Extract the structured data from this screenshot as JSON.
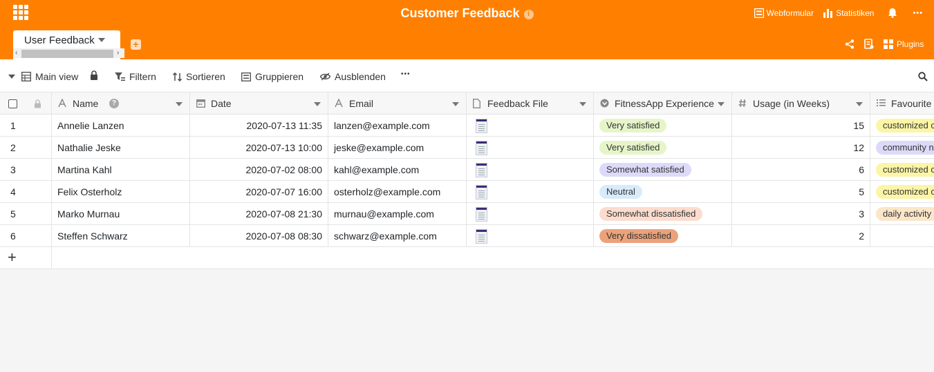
{
  "header": {
    "title": "Customer Feedback",
    "info_glyph": "i",
    "webform_label": "Webformular",
    "statistics_label": "Statistiken",
    "plugins_label": "Plugins",
    "more_glyph": "•••",
    "bg_color": "#ff8000"
  },
  "tabs": [
    {
      "label": "User Feedback"
    }
  ],
  "add_tab_glyph": "+",
  "toolbar": {
    "view_label": "Main view",
    "filter_label": "Filtern",
    "sort_label": "Sortieren",
    "group_label": "Gruppieren",
    "hide_label": "Ausblenden",
    "more_glyph": "•••"
  },
  "columns": [
    {
      "label": "Name",
      "icon": "text-icon"
    },
    {
      "label": "Date",
      "icon": "calendar-icon"
    },
    {
      "label": "Email",
      "icon": "text-icon"
    },
    {
      "label": "Feedback File",
      "icon": "file-icon"
    },
    {
      "label": "FitnessApp Experience",
      "icon": "single-select-icon"
    },
    {
      "label": "Usage (in Weeks)",
      "icon": "number-icon"
    },
    {
      "label": "Favourite F",
      "icon": "multi-select-icon"
    }
  ],
  "rows": [
    {
      "num": "1",
      "name": "Annelie Lanzen",
      "date": "2020-07-13 11:35",
      "email": "lanzen@example.com",
      "experience": "Very satisfied",
      "exp_color": "#e6f5c8",
      "usage": "15",
      "favourite": "customized c",
      "fav_color": "#fbf5a6"
    },
    {
      "num": "2",
      "name": "Nathalie Jeske",
      "date": "2020-07-13 10:00",
      "email": "jeske@example.com",
      "experience": "Very satisfied",
      "exp_color": "#e6f5c8",
      "usage": "12",
      "favourite": "community n",
      "fav_color": "#dcdaf8"
    },
    {
      "num": "3",
      "name": "Martina Kahl",
      "date": "2020-07-02 08:00",
      "email": "kahl@example.com",
      "experience": "Somewhat satisfied",
      "exp_color": "#dcdaf8",
      "usage": "6",
      "favourite": "customized c",
      "fav_color": "#fbf5a6"
    },
    {
      "num": "4",
      "name": "Felix Osterholz",
      "date": "2020-07-07 16:00",
      "email": "osterholz@example.com",
      "experience": "Neutral",
      "exp_color": "#d7ebfa",
      "usage": "5",
      "favourite": "customized c",
      "fav_color": "#fbf5a6"
    },
    {
      "num": "5",
      "name": "Marko Murnau",
      "date": "2020-07-08 21:30",
      "email": "murnau@example.com",
      "experience": "Somewhat dissatisfied",
      "exp_color": "#fbdccd",
      "usage": "3",
      "favourite": "daily activity",
      "fav_color": "#fbe6c8"
    },
    {
      "num": "6",
      "name": "Steffen Schwarz",
      "date": "2020-07-08 08:30",
      "email": "schwarz@example.com",
      "experience": "Very dissatisfied",
      "exp_color": "#eba27a",
      "usage": "2",
      "favourite": "",
      "fav_color": ""
    }
  ],
  "add_row_glyph": "+"
}
